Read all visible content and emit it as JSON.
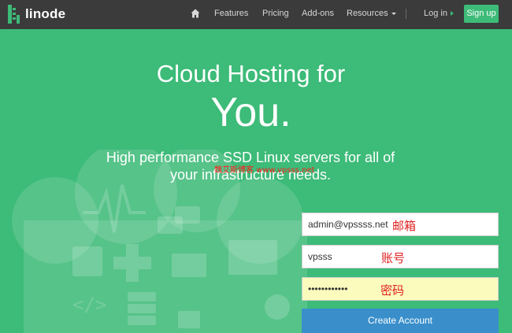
{
  "nav": {
    "logo_text": "linode",
    "items": [
      "Features",
      "Pricing",
      "Add-ons",
      "Resources"
    ],
    "login_label": "Log in",
    "signup_label": "Sign up"
  },
  "hero": {
    "line1": "Cloud Hosting for",
    "line2": "You.",
    "subtitle": "High performance SSD Linux servers for all of your infrastructure needs.",
    "watermark": "魏艾斯博客 www.vpsss.net"
  },
  "form": {
    "email_value": "admin@vpssss.net",
    "email_annotation": "邮箱",
    "username_value": "vpsss",
    "username_annotation": "账号",
    "password_value": "••••••••••••",
    "password_annotation": "密码",
    "submit_label": "Create Account"
  },
  "colors": {
    "nav_bg": "#3b3b3b",
    "brand_green": "#3dbb78",
    "button_blue": "#3a8fcb",
    "annotation_red": "#e02020"
  },
  "icons": [
    "home-icon",
    "cloud-illustration",
    "pulse-icon",
    "chat-bubbles-icon",
    "shopping-bag-icon",
    "dpad-icon",
    "mail-icon",
    "browser-window-icon",
    "code-icon",
    "server-stack-icon",
    "lock-icon",
    "gear-icon"
  ]
}
